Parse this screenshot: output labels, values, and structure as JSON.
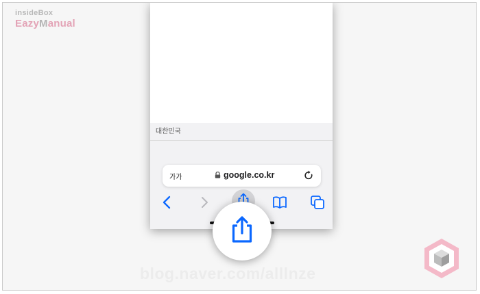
{
  "brand": {
    "top": "insideBox",
    "bottom_a": "Eazy",
    "bottom_b": "M",
    "bottom_c": "anual"
  },
  "page": {
    "region_text": "대한민국"
  },
  "address_bar": {
    "text_size_label": "가가",
    "url": "google.co.kr"
  },
  "toolbar": {
    "back": "back-chevron-icon",
    "forward": "forward-chevron-icon",
    "share": "share-icon",
    "bookmarks": "book-icon",
    "tabs": "tabs-icon"
  },
  "footer": {
    "blog_url": "blog.naver.com/alllnze"
  },
  "colors": {
    "ios_blue": "#0a67ff",
    "brand_pink": "#e3a3b6",
    "page_bg": "#f6f6f6"
  }
}
